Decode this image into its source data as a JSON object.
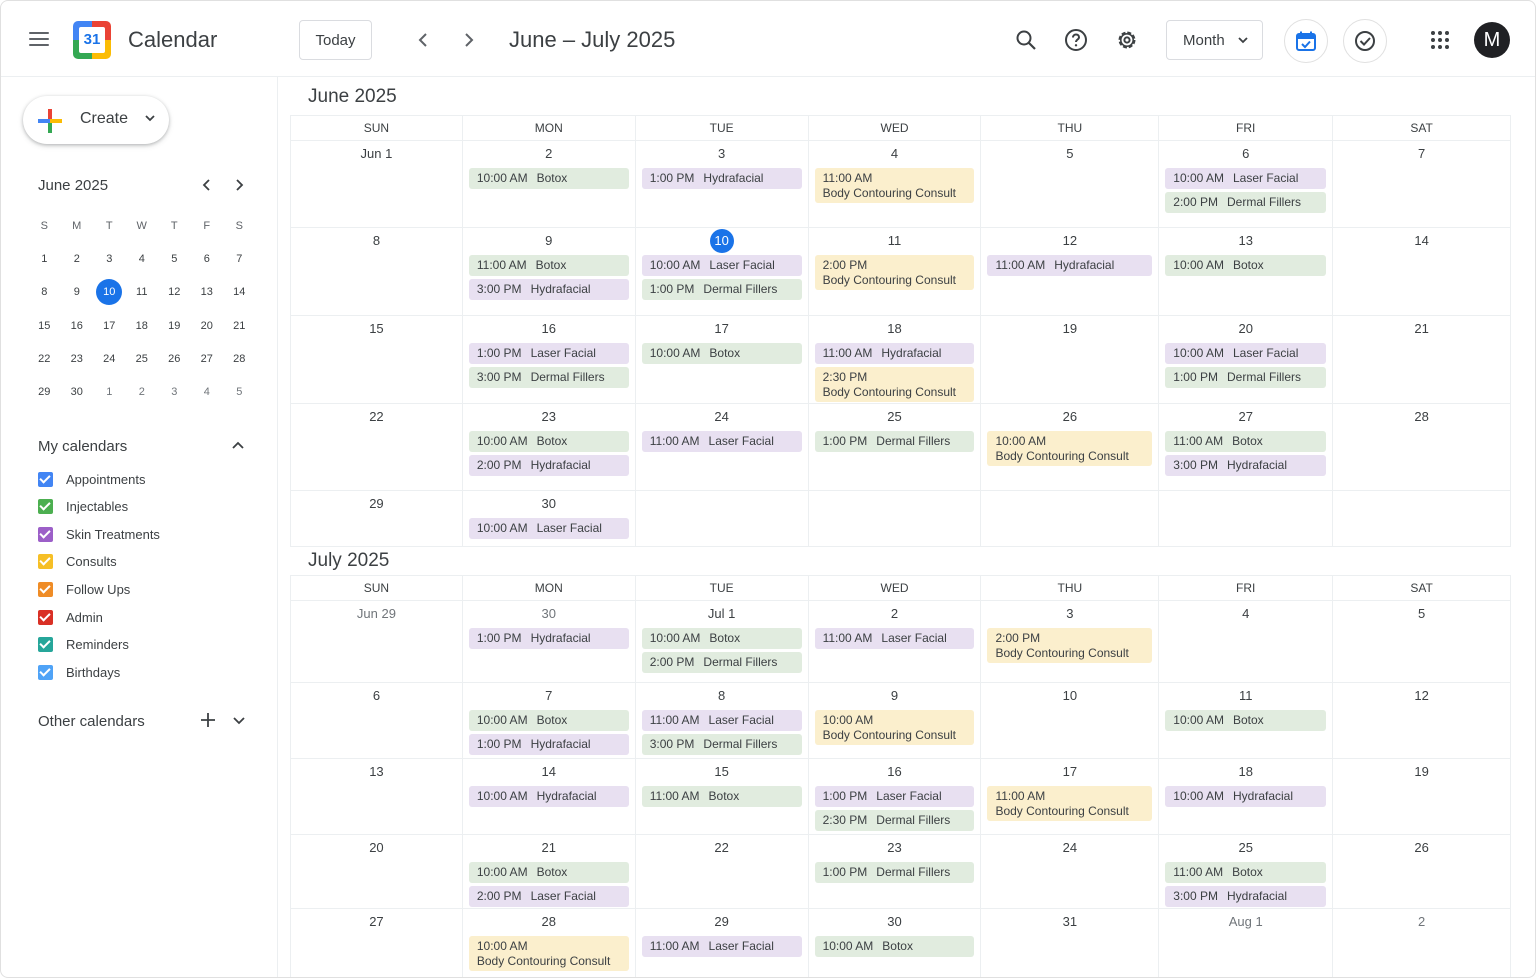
{
  "app": {
    "title": "Calendar",
    "logo_day": "31",
    "range_title": "June – July 2025",
    "today_label": "Today",
    "view": "Month",
    "avatar_initial": "M"
  },
  "colors": {
    "injectables": "#e1ecdf",
    "skin": "#e8e0f1",
    "consults": "#fbefcd",
    "accent": "#1a73e8"
  },
  "sidebar": {
    "create_label": "Create",
    "mini": {
      "title": "June 2025",
      "dow": [
        "S",
        "M",
        "T",
        "W",
        "T",
        "F",
        "S"
      ],
      "weeks": [
        [
          "1",
          "2",
          "3",
          "4",
          "5",
          "6",
          "7"
        ],
        [
          "8",
          "9",
          "10",
          "11",
          "12",
          "13",
          "14"
        ],
        [
          "15",
          "16",
          "17",
          "18",
          "19",
          "20",
          "21"
        ],
        [
          "22",
          "23",
          "24",
          "25",
          "26",
          "27",
          "28"
        ],
        [
          "29",
          "30",
          "1",
          "2",
          "3",
          "4",
          "5"
        ]
      ],
      "selected": "10"
    },
    "my_calendars_label": "My calendars",
    "my_calendars": [
      {
        "name": "Appointments",
        "color": "#4285f4"
      },
      {
        "name": "Injectables",
        "color": "#4caf50"
      },
      {
        "name": "Skin Treatments",
        "color": "#9c5fc8"
      },
      {
        "name": "Consults",
        "color": "#f6bf26"
      },
      {
        "name": "Follow Ups",
        "color": "#ef8c26"
      },
      {
        "name": "Admin",
        "color": "#d93025"
      },
      {
        "name": "Reminders",
        "color": "#26a69a"
      },
      {
        "name": "Birthdays",
        "color": "#4fa3f7"
      }
    ],
    "other_calendars_label": "Other calendars"
  },
  "months": [
    {
      "title": "June 2025",
      "dow": [
        "SUN",
        "MON",
        "TUE",
        "WED",
        "THU",
        "FRI",
        "SAT"
      ],
      "weeks": [
        {
          "days": [
            {
              "d": "Jun 1",
              "ev": []
            },
            {
              "d": "2",
              "ev": [
                {
                  "time": "10:00 AM",
                  "title": "Botox",
                  "cal": "inj"
                }
              ]
            },
            {
              "d": "3",
              "ev": [
                {
                  "time": "1:00 PM",
                  "title": "Hydrafacial",
                  "cal": "skin"
                }
              ]
            },
            {
              "d": "4",
              "ev": [
                {
                  "time": "11:00 AM",
                  "title": "Body Contouring Consult",
                  "cal": "cons",
                  "two": true
                }
              ]
            },
            {
              "d": "5",
              "ev": []
            },
            {
              "d": "6",
              "ev": [
                {
                  "time": "10:00 AM",
                  "title": "Laser Facial",
                  "cal": "skin"
                },
                {
                  "time": "2:00 PM",
                  "title": "Dermal Fillers",
                  "cal": "inj"
                }
              ]
            },
            {
              "d": "7",
              "ev": []
            }
          ]
        },
        {
          "days": [
            {
              "d": "8",
              "ev": []
            },
            {
              "d": "9",
              "ev": [
                {
                  "time": "11:00 AM",
                  "title": "Botox",
                  "cal": "inj"
                },
                {
                  "time": "3:00 PM",
                  "title": "Hydrafacial",
                  "cal": "skin"
                }
              ]
            },
            {
              "d": "10",
              "today": true,
              "ev": [
                {
                  "time": "10:00 AM",
                  "title": "Laser Facial",
                  "cal": "skin"
                },
                {
                  "time": "1:00 PM",
                  "title": "Dermal Fillers",
                  "cal": "inj"
                }
              ]
            },
            {
              "d": "11",
              "ev": [
                {
                  "time": "2:00 PM",
                  "title": "Body Contouring Consult",
                  "cal": "cons",
                  "two": true
                }
              ]
            },
            {
              "d": "12",
              "ev": [
                {
                  "time": "11:00 AM",
                  "title": "Hydrafacial",
                  "cal": "skin"
                }
              ]
            },
            {
              "d": "13",
              "ev": [
                {
                  "time": "10:00 AM",
                  "title": "Botox",
                  "cal": "inj"
                }
              ]
            },
            {
              "d": "14",
              "ev": []
            }
          ]
        },
        {
          "days": [
            {
              "d": "15",
              "ev": []
            },
            {
              "d": "16",
              "ev": [
                {
                  "time": "1:00 PM",
                  "title": "Laser Facial",
                  "cal": "skin"
                },
                {
                  "time": "3:00 PM",
                  "title": "Dermal Fillers",
                  "cal": "inj"
                }
              ]
            },
            {
              "d": "17",
              "ev": [
                {
                  "time": "10:00 AM",
                  "title": "Botox",
                  "cal": "inj"
                }
              ]
            },
            {
              "d": "18",
              "ev": [
                {
                  "time": "11:00 AM",
                  "title": "Hydrafacial",
                  "cal": "skin"
                },
                {
                  "time": "2:30 PM",
                  "title": "Body Contouring Consult",
                  "cal": "cons",
                  "two": true
                }
              ]
            },
            {
              "d": "19",
              "ev": []
            },
            {
              "d": "20",
              "ev": [
                {
                  "time": "10:00 AM",
                  "title": "Laser Facial",
                  "cal": "skin"
                },
                {
                  "time": "1:00 PM",
                  "title": "Dermal Fillers",
                  "cal": "inj"
                }
              ]
            },
            {
              "d": "21",
              "ev": []
            }
          ]
        },
        {
          "days": [
            {
              "d": "22",
              "ev": []
            },
            {
              "d": "23",
              "ev": [
                {
                  "time": "10:00 AM",
                  "title": "Botox",
                  "cal": "inj"
                },
                {
                  "time": "2:00 PM",
                  "title": "Hydrafacial",
                  "cal": "skin"
                }
              ]
            },
            {
              "d": "24",
              "ev": [
                {
                  "time": "11:00 AM",
                  "title": "Laser Facial",
                  "cal": "skin"
                }
              ]
            },
            {
              "d": "25",
              "ev": [
                {
                  "time": "1:00 PM",
                  "title": "Dermal Fillers",
                  "cal": "inj"
                }
              ]
            },
            {
              "d": "26",
              "ev": [
                {
                  "time": "10:00 AM",
                  "title": "Body Contouring Consult",
                  "cal": "cons",
                  "two": true
                }
              ]
            },
            {
              "d": "27",
              "ev": [
                {
                  "time": "11:00 AM",
                  "title": "Botox",
                  "cal": "inj"
                },
                {
                  "time": "3:00 PM",
                  "title": "Hydrafacial",
                  "cal": "skin"
                }
              ]
            },
            {
              "d": "28",
              "ev": []
            }
          ]
        },
        {
          "days": [
            {
              "d": "29",
              "ev": []
            },
            {
              "d": "30",
              "ev": [
                {
                  "time": "10:00 AM",
                  "title": "Laser Facial",
                  "cal": "skin"
                }
              ]
            },
            {
              "d": "",
              "ev": []
            },
            {
              "d": "",
              "ev": []
            },
            {
              "d": "",
              "ev": []
            },
            {
              "d": "",
              "ev": []
            },
            {
              "d": "",
              "ev": []
            }
          ]
        }
      ]
    },
    {
      "title": "July 2025",
      "dow": [
        "SUN",
        "MON",
        "TUE",
        "WED",
        "THU",
        "FRI",
        "SAT"
      ],
      "weeks": [
        {
          "days": [
            {
              "d": "Jun 29",
              "muted": true,
              "ev": []
            },
            {
              "d": "30",
              "muted": true,
              "ev": [
                {
                  "time": "1:00 PM",
                  "title": "Hydrafacial",
                  "cal": "skin"
                }
              ]
            },
            {
              "d": "Jul 1",
              "ev": [
                {
                  "time": "10:00 AM",
                  "title": "Botox",
                  "cal": "inj"
                },
                {
                  "time": "2:00 PM",
                  "title": "Dermal Fillers",
                  "cal": "inj"
                }
              ]
            },
            {
              "d": "2",
              "ev": [
                {
                  "time": "11:00 AM",
                  "title": "Laser Facial",
                  "cal": "skin"
                }
              ]
            },
            {
              "d": "3",
              "ev": [
                {
                  "time": "2:00 PM",
                  "title": "Body Contouring Consult",
                  "cal": "cons",
                  "two": true
                }
              ]
            },
            {
              "d": "4",
              "ev": []
            },
            {
              "d": "5",
              "ev": []
            }
          ]
        },
        {
          "days": [
            {
              "d": "6",
              "ev": []
            },
            {
              "d": "7",
              "ev": [
                {
                  "time": "10:00 AM",
                  "title": "Botox",
                  "cal": "inj"
                },
                {
                  "time": "1:00 PM",
                  "title": "Hydrafacial",
                  "cal": "skin"
                }
              ]
            },
            {
              "d": "8",
              "ev": [
                {
                  "time": "11:00 AM",
                  "title": "Laser Facial",
                  "cal": "skin"
                },
                {
                  "time": "3:00 PM",
                  "title": "Dermal Fillers",
                  "cal": "inj"
                }
              ]
            },
            {
              "d": "9",
              "ev": [
                {
                  "time": "10:00 AM",
                  "title": "Body Contouring Consult",
                  "cal": "cons",
                  "two": true
                }
              ]
            },
            {
              "d": "10",
              "ev": []
            },
            {
              "d": "11",
              "ev": [
                {
                  "time": "10:00 AM",
                  "title": "Botox",
                  "cal": "inj"
                }
              ]
            },
            {
              "d": "12",
              "ev": []
            }
          ]
        },
        {
          "days": [
            {
              "d": "13",
              "ev": []
            },
            {
              "d": "14",
              "ev": [
                {
                  "time": "10:00 AM",
                  "title": "Hydrafacial",
                  "cal": "skin"
                }
              ]
            },
            {
              "d": "15",
              "ev": [
                {
                  "time": "11:00 AM",
                  "title": "Botox",
                  "cal": "inj"
                }
              ]
            },
            {
              "d": "16",
              "ev": [
                {
                  "time": "1:00 PM",
                  "title": "Laser Facial",
                  "cal": "skin"
                },
                {
                  "time": "2:30 PM",
                  "title": "Dermal Fillers",
                  "cal": "inj"
                }
              ]
            },
            {
              "d": "17",
              "ev": [
                {
                  "time": "11:00 AM",
                  "title": "Body Contouring Consult",
                  "cal": "cons",
                  "two": true
                }
              ]
            },
            {
              "d": "18",
              "ev": [
                {
                  "time": "10:00 AM",
                  "title": "Hydrafacial",
                  "cal": "skin"
                }
              ]
            },
            {
              "d": "19",
              "ev": []
            }
          ]
        },
        {
          "days": [
            {
              "d": "20",
              "ev": []
            },
            {
              "d": "21",
              "ev": [
                {
                  "time": "10:00 AM",
                  "title": "Botox",
                  "cal": "inj"
                },
                {
                  "time": "2:00 PM",
                  "title": "Laser Facial",
                  "cal": "skin"
                }
              ]
            },
            {
              "d": "22",
              "ev": []
            },
            {
              "d": "23",
              "ev": [
                {
                  "time": "1:00 PM",
                  "title": "Dermal Fillers",
                  "cal": "inj"
                }
              ]
            },
            {
              "d": "24",
              "ev": []
            },
            {
              "d": "25",
              "ev": [
                {
                  "time": "11:00 AM",
                  "title": "Botox",
                  "cal": "inj"
                },
                {
                  "time": "3:00 PM",
                  "title": "Hydrafacial",
                  "cal": "skin"
                }
              ]
            },
            {
              "d": "26",
              "ev": []
            }
          ]
        },
        {
          "days": [
            {
              "d": "27",
              "ev": []
            },
            {
              "d": "28",
              "ev": [
                {
                  "time": "10:00 AM",
                  "title": "Body Contouring Consult",
                  "cal": "cons",
                  "two": true
                }
              ]
            },
            {
              "d": "29",
              "ev": [
                {
                  "time": "11:00 AM",
                  "title": "Laser Facial",
                  "cal": "skin"
                }
              ]
            },
            {
              "d": "30",
              "ev": [
                {
                  "time": "10:00 AM",
                  "title": "Botox",
                  "cal": "inj"
                }
              ]
            },
            {
              "d": "31",
              "ev": []
            },
            {
              "d": "Aug 1",
              "muted": true,
              "ev": []
            },
            {
              "d": "2",
              "muted": true,
              "ev": []
            }
          ]
        }
      ]
    }
  ]
}
